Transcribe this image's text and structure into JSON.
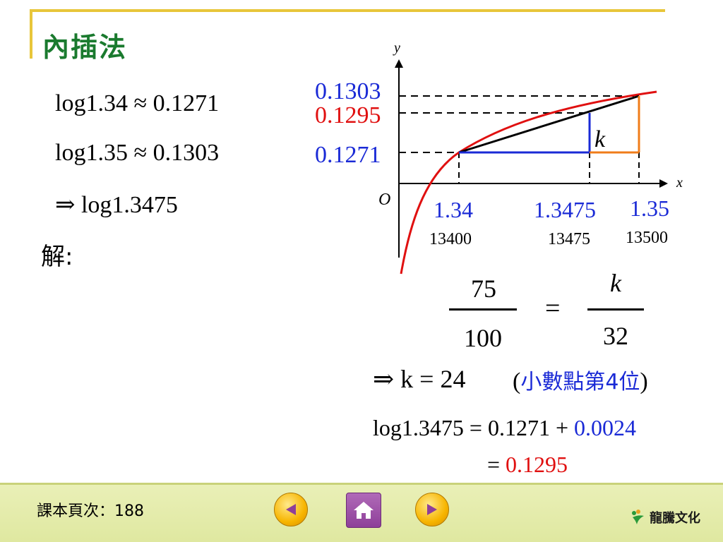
{
  "title": "內插法",
  "equations": {
    "line1": "log1.34 ≈ 0.1271",
    "line2": "log1.35 ≈ 0.1303",
    "line3": "⇒ log1.3475",
    "solve_label": "解:"
  },
  "graph": {
    "y_axis_label": "y",
    "x_axis_label": "x",
    "origin_label": "O",
    "y_ticks": {
      "top": "0.1303",
      "mid": "0.1295",
      "low": "0.1271"
    },
    "x_ticks": {
      "left": "1.34",
      "mid": "1.3475",
      "right": "1.35"
    },
    "x_sub": {
      "left": "13400",
      "mid": "13475",
      "right": "13500"
    },
    "k_label": "k",
    "colors": {
      "curve": "#e01010",
      "blue": "#1a2ad6",
      "orange": "#f07c1a",
      "black": "#000000"
    }
  },
  "fraction": {
    "left_num": "75",
    "left_den": "100",
    "equals": "=",
    "right_num": "k",
    "right_den": "32"
  },
  "result": {
    "k_line": "⇒ k = 24",
    "note_open": "(",
    "note_text": "小數點第4位",
    "note_close": ")"
  },
  "sum": {
    "lhs": "log1.3475 = 0.1271 + ",
    "addend": "0.0024",
    "eq2_prefix": "= ",
    "answer": "0.1295"
  },
  "footer": {
    "page_ref": "課本頁次：188",
    "brand": "龍騰文化"
  }
}
